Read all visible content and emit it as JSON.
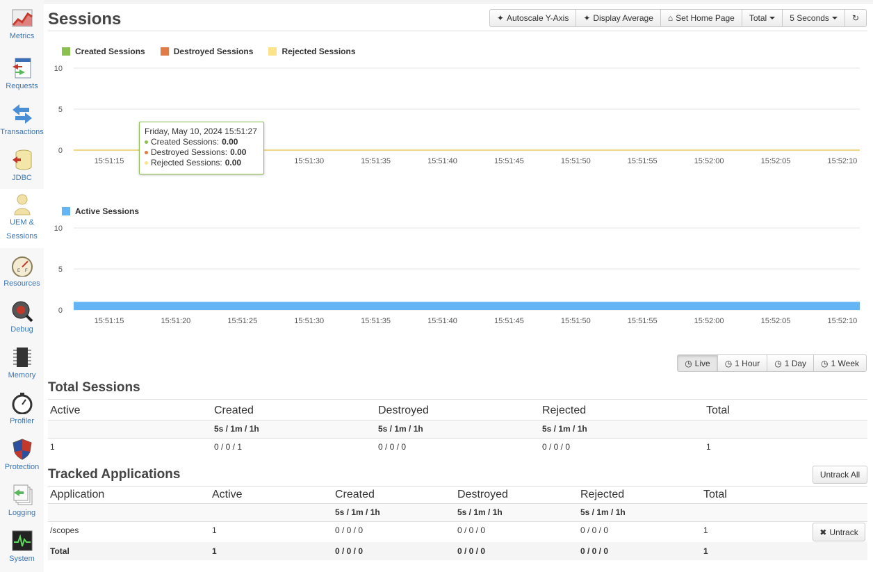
{
  "sidebar": {
    "items": [
      {
        "label": "Metrics",
        "icon": "chart-icon"
      },
      {
        "label": "Requests",
        "icon": "request-icon"
      },
      {
        "label": "Transactions",
        "icon": "transactions-icon"
      },
      {
        "label": "JDBC",
        "icon": "database-icon"
      },
      {
        "label": "UEM &",
        "label2": "Sessions",
        "icon": "user-icon",
        "active": true
      },
      {
        "label": "Resources",
        "icon": "gauge-icon"
      },
      {
        "label": "Debug",
        "icon": "bug-icon"
      },
      {
        "label": "Memory",
        "icon": "chip-icon"
      },
      {
        "label": "Profiler",
        "icon": "stopwatch-icon"
      },
      {
        "label": "Protection",
        "icon": "shield-icon"
      },
      {
        "label": "Logging",
        "icon": "log-icon"
      },
      {
        "label": "System",
        "icon": "monitor-icon"
      }
    ]
  },
  "page": {
    "title": "Sessions"
  },
  "toolbar": {
    "autoscale": "Autoscale Y-Axis",
    "average": "Display Average",
    "home": "Set Home Page",
    "total": "Total",
    "interval": "5 Seconds"
  },
  "colors": {
    "created": "#8cc152",
    "destroyed": "#e07b4a",
    "rejected": "#fbe38c",
    "active": "#64b5f6"
  },
  "chart_data": [
    {
      "type": "line",
      "legend": [
        "Created Sessions",
        "Destroyed Sessions",
        "Rejected Sessions"
      ],
      "x": [
        "15:51:15",
        "15:51:20",
        "15:51:25",
        "15:51:30",
        "15:51:35",
        "15:51:40",
        "15:51:45",
        "15:51:50",
        "15:51:55",
        "15:52:00",
        "15:52:05",
        "15:52:10"
      ],
      "y_ticks": [
        "10",
        "5",
        "0"
      ],
      "ylim": [
        0,
        10
      ],
      "series": [
        {
          "name": "Created Sessions",
          "values": [
            0,
            0,
            0,
            0,
            0,
            0,
            0,
            0,
            0,
            0,
            0,
            0
          ]
        },
        {
          "name": "Destroyed Sessions",
          "values": [
            0,
            0,
            0,
            0,
            0,
            0,
            0,
            0,
            0,
            0,
            0,
            0
          ]
        },
        {
          "name": "Rejected Sessions",
          "values": [
            0,
            0,
            0,
            0,
            0,
            0,
            0,
            0,
            0,
            0,
            0,
            0
          ]
        }
      ],
      "tooltip": {
        "date": "Friday, May 10, 2024 15:51:27",
        "rows": [
          {
            "label": "Created Sessions:",
            "value": "0.00"
          },
          {
            "label": "Destroyed Sessions:",
            "value": "0.00"
          },
          {
            "label": "Rejected Sessions:",
            "value": "0.00"
          }
        ]
      }
    },
    {
      "type": "area",
      "legend": [
        "Active Sessions"
      ],
      "x": [
        "15:51:15",
        "15:51:20",
        "15:51:25",
        "15:51:30",
        "15:51:35",
        "15:51:40",
        "15:51:45",
        "15:51:50",
        "15:51:55",
        "15:52:00",
        "15:52:05",
        "15:52:10"
      ],
      "y_ticks": [
        "10",
        "5",
        "0"
      ],
      "ylim": [
        0,
        10
      ],
      "series": [
        {
          "name": "Active Sessions",
          "values": [
            1,
            1,
            1,
            1,
            1,
            1,
            1,
            1,
            1,
            1,
            1,
            1
          ]
        }
      ]
    }
  ],
  "ranges": [
    "Live",
    "1 Hour",
    "1 Day",
    "1 Week"
  ],
  "total_sessions": {
    "title": "Total Sessions",
    "headers": [
      "Active",
      "Created",
      "Destroyed",
      "Rejected",
      "Total"
    ],
    "sub": [
      "",
      "5s / 1m / 1h",
      "5s / 1m / 1h",
      "5s / 1m / 1h",
      ""
    ],
    "row": [
      "1",
      "0 / 0 / 1",
      "0 / 0 / 0",
      "0 / 0 / 0",
      "1"
    ]
  },
  "tracked": {
    "title": "Tracked Applications",
    "untrack_all": "Untrack All",
    "untrack": "Untrack",
    "headers": [
      "Application",
      "Active",
      "Created",
      "Destroyed",
      "Rejected",
      "Total"
    ],
    "sub": [
      "",
      "",
      "5s / 1m / 1h",
      "5s / 1m / 1h",
      "5s / 1m / 1h",
      ""
    ],
    "row": [
      "/scopes",
      "1",
      "0 / 0 / 0",
      "0 / 0 / 0",
      "0 / 0 / 0",
      "1"
    ],
    "total": [
      "Total",
      "1",
      "0 / 0 / 0",
      "0 / 0 / 0",
      "0 / 0 / 0",
      "1"
    ]
  }
}
